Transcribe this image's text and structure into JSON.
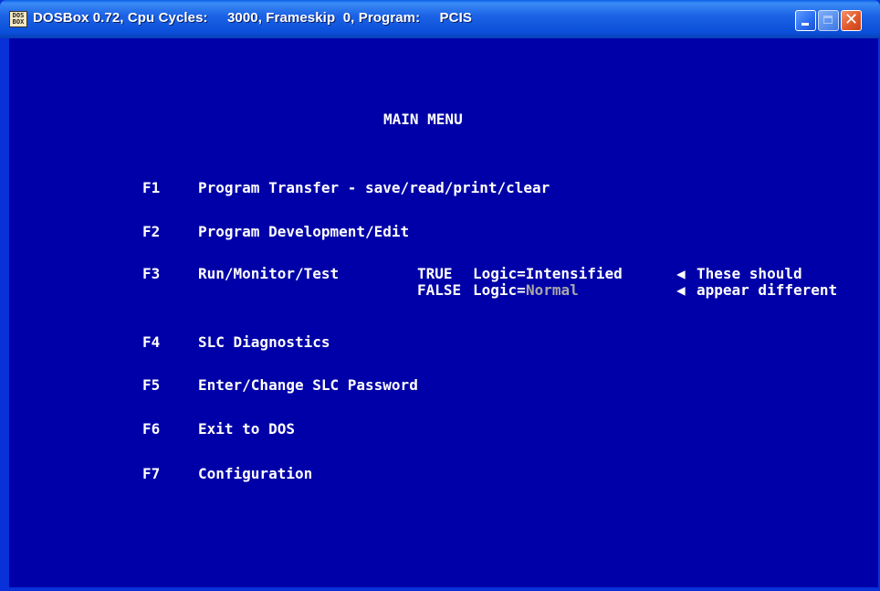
{
  "window": {
    "title": "DOSBox 0.72, Cpu Cycles:     3000, Frameskip  0, Program:     PCIS",
    "icon_text": [
      "DOS",
      "BOX"
    ],
    "buttons": {
      "minimize": "minimize-icon",
      "maximize": "maximize-icon",
      "close_label": "✕"
    }
  },
  "screen": {
    "background": "#0000a8",
    "heading": "MAIN MENU",
    "menu": [
      {
        "key": "F1",
        "label": "Program Transfer - save/read/print/clear"
      },
      {
        "key": "F2",
        "label": "Program Development/Edit"
      },
      {
        "key": "F3",
        "label": "Run/Monitor/Test"
      },
      {
        "key": "F4",
        "label": "SLC Diagnostics"
      },
      {
        "key": "F5",
        "label": "Enter/Change SLC Password"
      },
      {
        "key": "F6",
        "label": "Exit to DOS"
      },
      {
        "key": "F7",
        "label": "Configuration"
      }
    ],
    "logic_demo": {
      "true_word": "TRUE",
      "true_text": "Logic=Intensified",
      "false_word": "FALSE",
      "false_label": "Logic=",
      "false_value": "Normal",
      "arrow": "◀",
      "note_line1": "These should",
      "note_line2": "appear different"
    }
  }
}
